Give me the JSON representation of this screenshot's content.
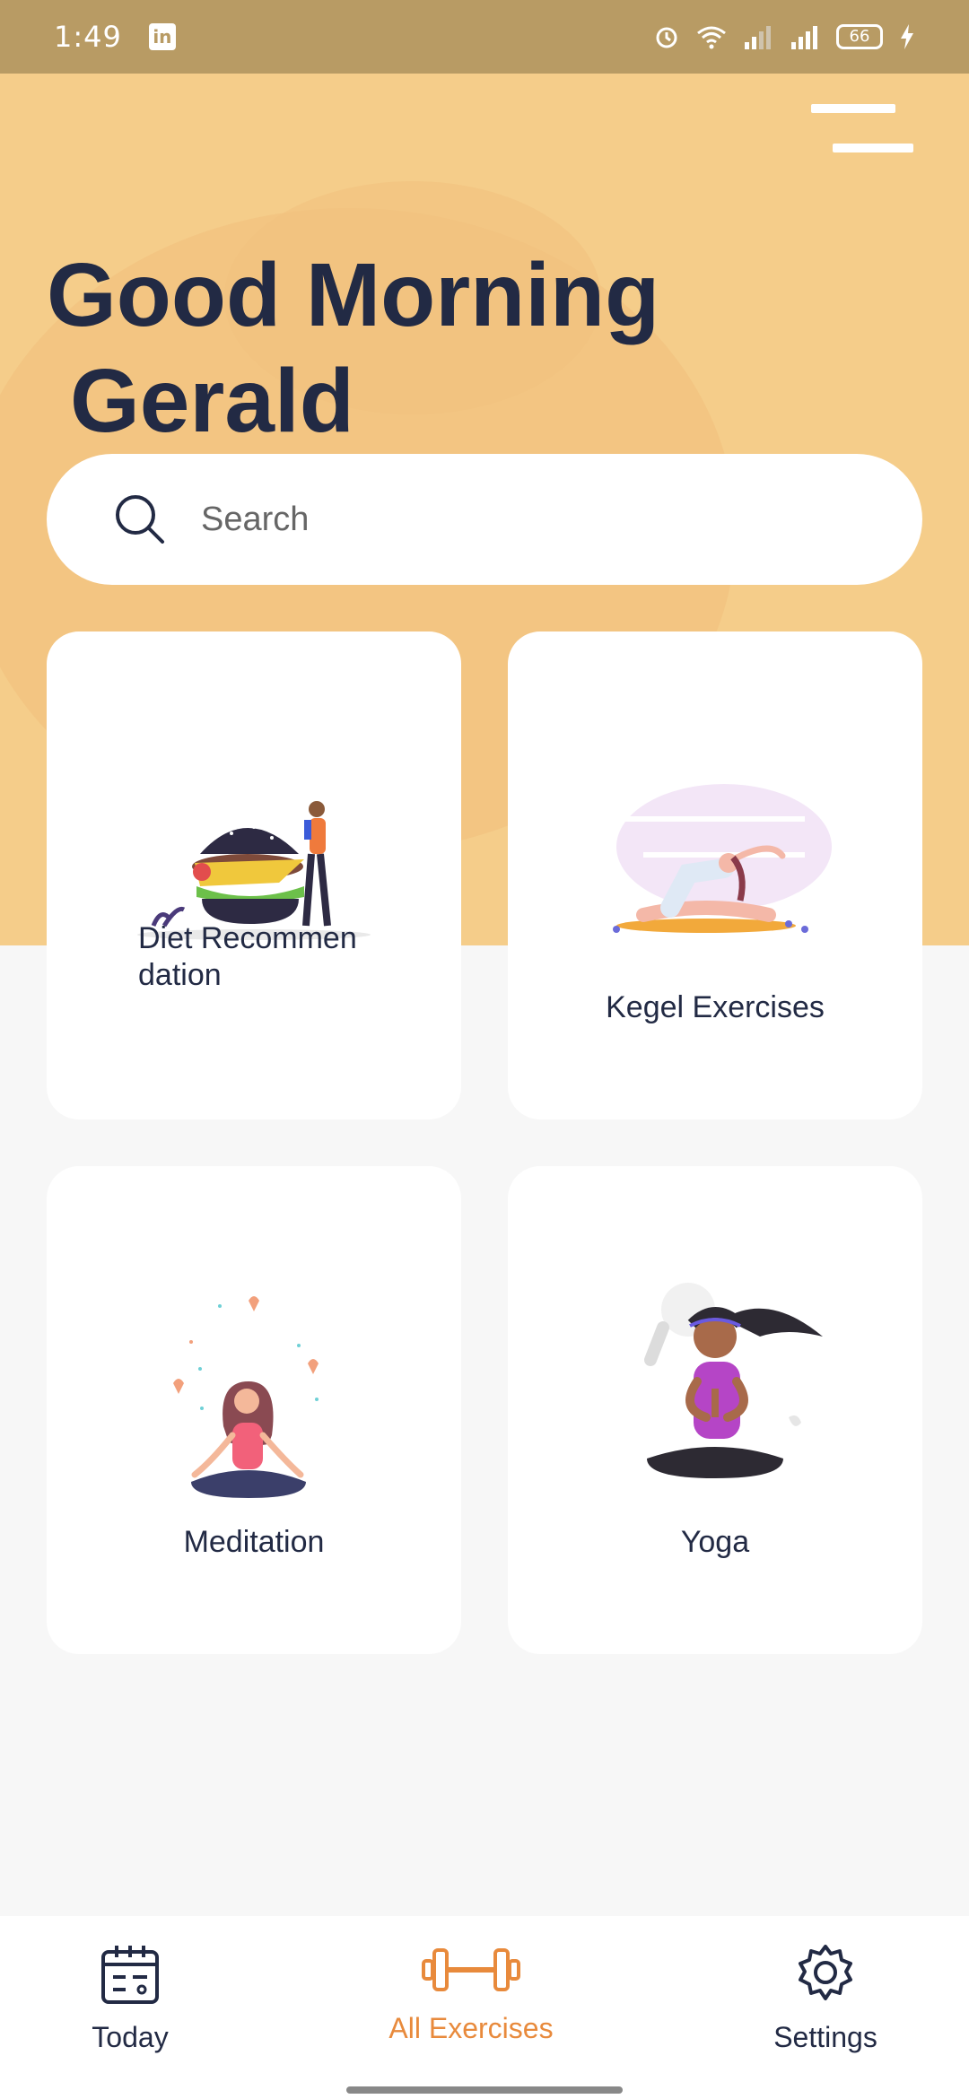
{
  "status_bar": {
    "time": "1:49",
    "battery": "66",
    "icons": [
      "linkedin-icon",
      "alarm-icon",
      "wifi-icon",
      "signal-icon",
      "signal-icon",
      "battery-icon",
      "charging-icon"
    ]
  },
  "header": {
    "greeting_line1": "Good Morning",
    "greeting_line2": "Gerald",
    "menu_icon": "menu-icon"
  },
  "search": {
    "placeholder": "Search",
    "icon": "search-icon"
  },
  "cards": [
    {
      "label": "Diet Recommendation",
      "illustration": "burger-illustration"
    },
    {
      "label": "Kegel Exercises",
      "illustration": "stretching-illustration"
    },
    {
      "label": "Meditation",
      "illustration": "meditation-illustration"
    },
    {
      "label": "Yoga",
      "illustration": "yoga-illustration"
    }
  ],
  "bottom_nav": {
    "items": [
      {
        "label": "Today",
        "icon": "calendar-icon"
      },
      {
        "label": "All Exercises",
        "icon": "dumbbell-icon",
        "active": true
      },
      {
        "label": "Settings",
        "icon": "gear-icon"
      }
    ]
  },
  "colors": {
    "status_bar": "#b89b64",
    "header": "#f5cd8a",
    "text_dark": "#222a44",
    "accent": "#e88a3c",
    "background": "#f7f7f7"
  }
}
